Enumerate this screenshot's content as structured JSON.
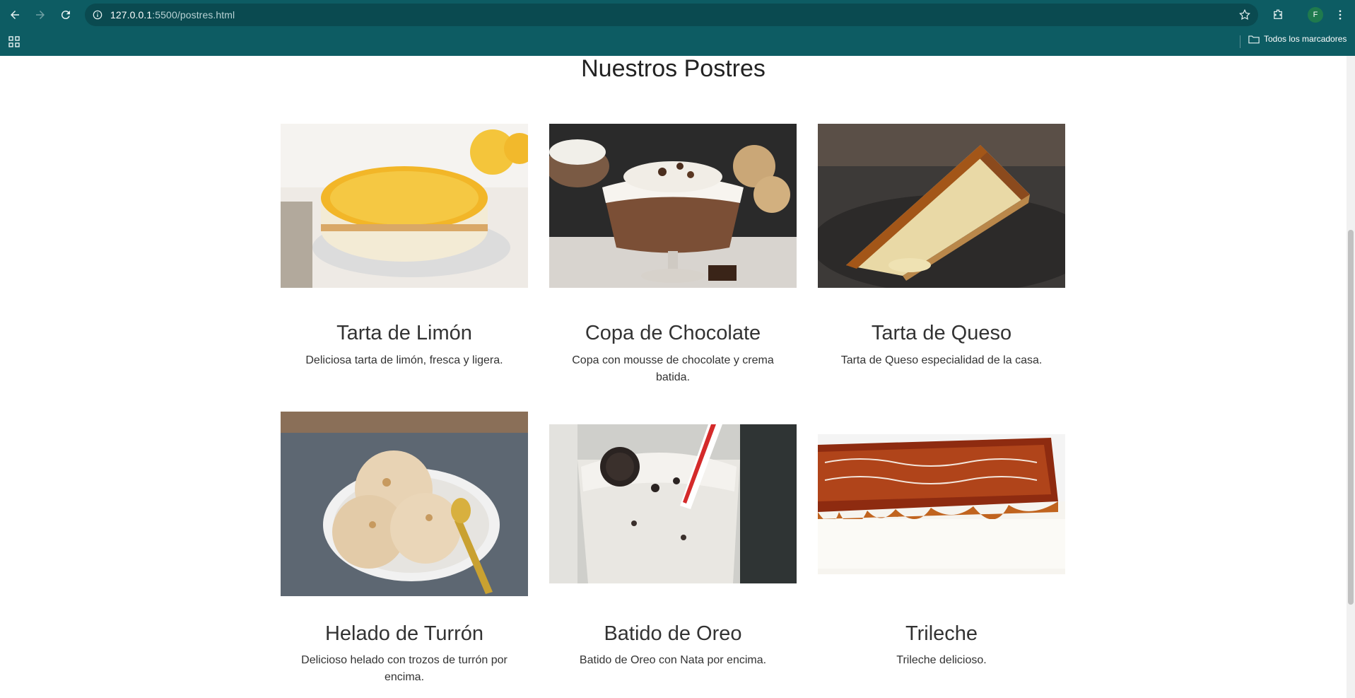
{
  "browser": {
    "url_host": "127.0.0.1",
    "url_path": ":5500/postres.html",
    "profile_initial": "F",
    "bookmarks_label": "Todos los marcadores"
  },
  "page": {
    "title": "Nuestros Postres"
  },
  "desserts": [
    {
      "name": "Tarta de Limón",
      "description": "Deliciosa tarta de limón, fresca y ligera."
    },
    {
      "name": "Copa de Chocolate",
      "description": "Copa con mousse de chocolate y crema batida."
    },
    {
      "name": "Tarta de Queso",
      "description": "Tarta de Queso especialidad de la casa."
    },
    {
      "name": "Helado de Turrón",
      "description": "Delicioso helado con trozos de turrón por encima."
    },
    {
      "name": "Batido de Oreo",
      "description": "Batido de Oreo con Nata por encima."
    },
    {
      "name": "Trileche",
      "description": "Trileche delicioso."
    }
  ]
}
